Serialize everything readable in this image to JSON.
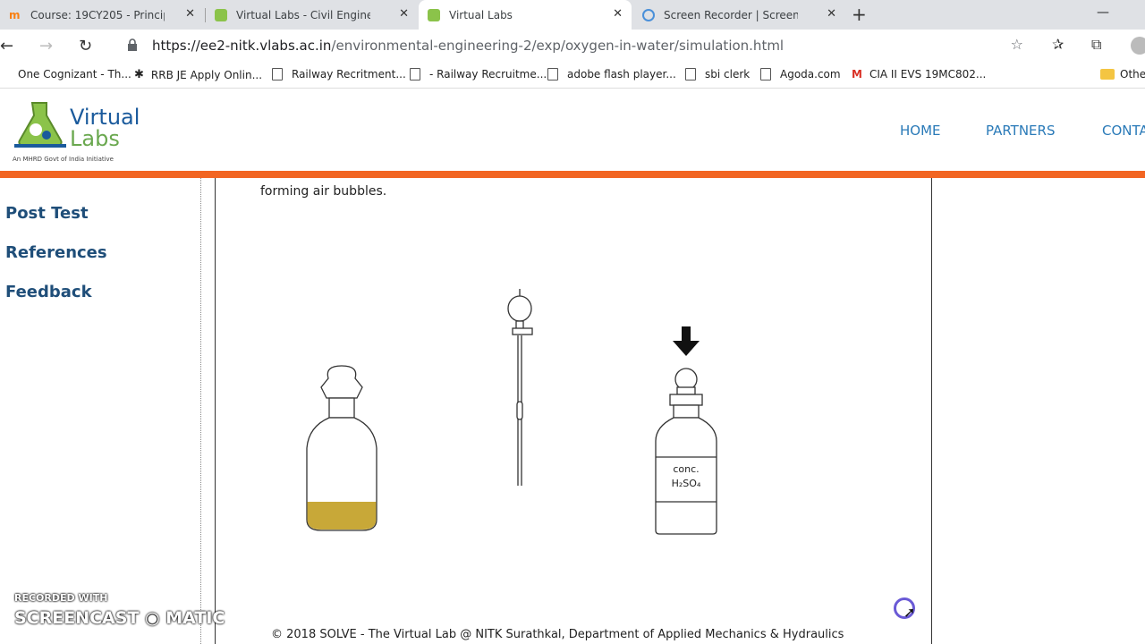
{
  "browser": {
    "tabs": [
      {
        "label": "Course: 19CY205 - Principles of",
        "active": false
      },
      {
        "label": "Virtual Labs - Civil Engineering",
        "active": false
      },
      {
        "label": "Virtual Labs",
        "active": true
      },
      {
        "label": "Screen Recorder | Screencast-O",
        "active": false
      }
    ],
    "url_host": "https://ee2-nitk.vlabs.ac.in",
    "url_path": "/environmental-engineering-2/exp/oxygen-in-water/simulation.html",
    "bookmarks": [
      "One Cognizant - Th...",
      "RRB JE Apply Onlin...",
      "Railway Recritment...",
      "- Railway Recruitme...",
      "adobe flash player...",
      "sbi clerk",
      "Agoda.com",
      "CIA II EVS 19MC802...",
      "Othe"
    ]
  },
  "site": {
    "logo_line1": "Virtual",
    "logo_line2": "Labs",
    "logo_sub": "An MHRD Govt of India Initiative",
    "menu": [
      "HOME",
      "PARTNERS",
      "CONTA"
    ],
    "accent": "#f26522"
  },
  "sidebar": {
    "items": [
      "Post Test",
      "References",
      "Feedback"
    ]
  },
  "content": {
    "description": "forming air bubbles.",
    "reagent_label_1": "conc.",
    "reagent_label_2": "H₂SO₄",
    "footer": "© 2018 SOLVE - The Virtual Lab @ NITK Surathkal, Department of Applied Mechanics & Hydraulics"
  },
  "watermark": {
    "line1": "RECORDED WITH",
    "line2": "SCREENCAST ◉ MATIC"
  }
}
